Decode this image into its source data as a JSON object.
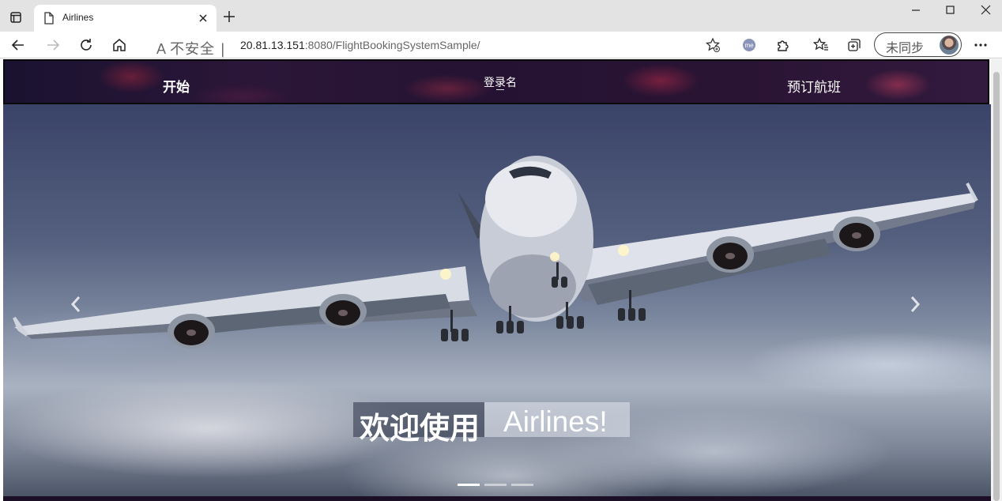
{
  "browser": {
    "tab_title": "Airlines",
    "security_label": "不安全",
    "url_host": "20.81.13.151",
    "url_rest": ":8080/FlightBookingSystemSample/",
    "sync_label": "未同步",
    "extension_badge": "me"
  },
  "nav": {
    "start": "开始",
    "login": "登录名",
    "book": "预订航班"
  },
  "carousel": {
    "caption_cn": "欢迎使用",
    "caption_en": "Airlines!",
    "slides": 3,
    "active_slide": 1
  }
}
